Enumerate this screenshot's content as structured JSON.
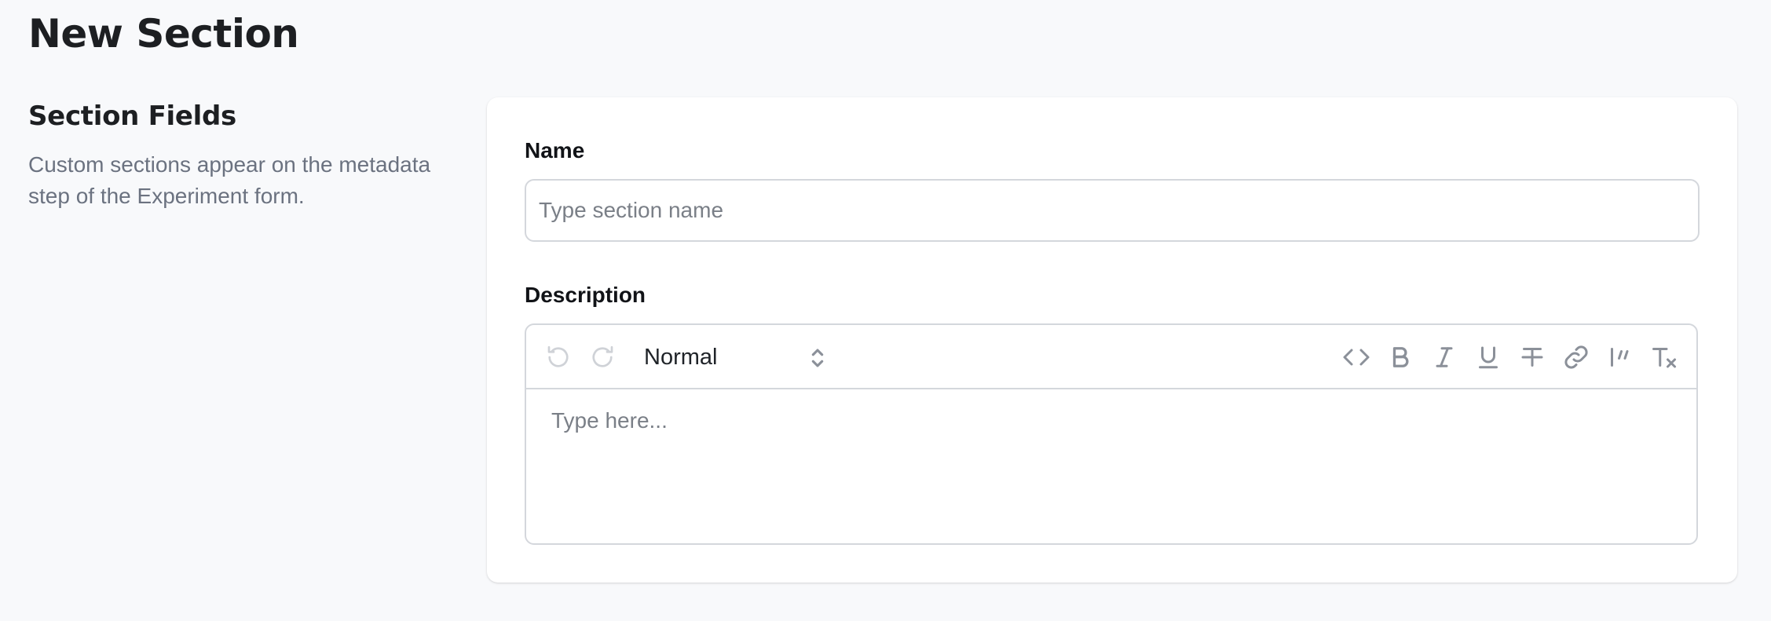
{
  "page": {
    "title": "New Section"
  },
  "sidebar": {
    "heading": "Section Fields",
    "description": "Custom sections appear on the metadata step of the Experiment form."
  },
  "form": {
    "name": {
      "label": "Name",
      "placeholder": "Type section name",
      "value": ""
    },
    "description": {
      "label": "Description",
      "placeholder": "Type here...",
      "value": ""
    }
  },
  "editor_toolbar": {
    "block_type": "Normal",
    "icons": [
      "undo-icon",
      "redo-icon",
      "chevron-up-down-icon",
      "code-icon",
      "bold-icon",
      "italic-icon",
      "underline-icon",
      "strikethrough-icon",
      "link-icon",
      "quote-icon",
      "clear-format-icon"
    ]
  },
  "colors": {
    "page_background": "#f8f9fb",
    "card_background": "#ffffff",
    "border": "#d4d7dc",
    "muted_text": "#6b7280",
    "icon_gray": "#8b9099",
    "icon_disabled": "#cfd2d7"
  }
}
